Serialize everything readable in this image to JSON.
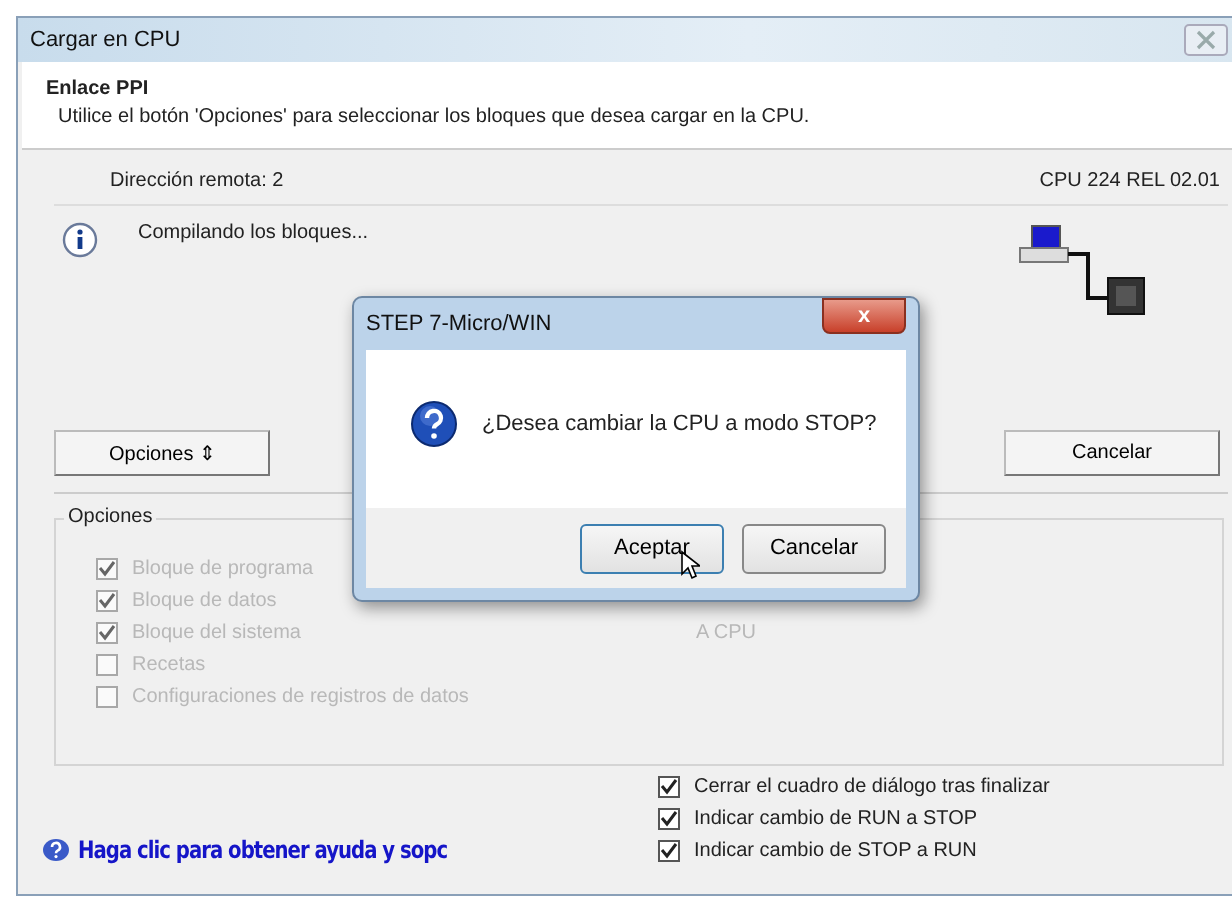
{
  "window": {
    "title": "Cargar en CPU"
  },
  "header": {
    "title": "Enlace PPI",
    "description": "Utilice el botón 'Opciones' para seleccionar los bloques que desea cargar en la CPU."
  },
  "connection": {
    "remote_address": "Dirección remota: 2",
    "cpu": "CPU 224 REL 02.01"
  },
  "status": {
    "message": "Compilando los bloques..."
  },
  "buttons": {
    "options": "Opciones ⇕",
    "cancel": "Cancelar"
  },
  "options_group": {
    "title": "Opciones",
    "items": [
      {
        "label": "Bloque de programa",
        "checked": true,
        "disabled": true
      },
      {
        "label": "Bloque de datos",
        "checked": true,
        "disabled": true
      },
      {
        "label": "Bloque del sistema",
        "checked": true,
        "disabled": true
      },
      {
        "label": "Recetas",
        "checked": false,
        "disabled": true
      },
      {
        "label": "Configuraciones de registros de datos",
        "checked": false,
        "disabled": true
      }
    ],
    "target": "A CPU"
  },
  "settings": [
    {
      "label": "Cerrar el cuadro de diálogo tras finalizar",
      "checked": true
    },
    {
      "label": "Indicar cambio de RUN a STOP",
      "checked": true
    },
    {
      "label": "Indicar cambio de STOP a RUN",
      "checked": true
    }
  ],
  "help_link": "Haga clic para obtener ayuda y sopc",
  "dialog": {
    "title": "STEP 7-Micro/WIN",
    "close": "x",
    "message": "¿Desea cambiar la CPU a modo STOP?",
    "buttons": [
      "Aceptar",
      "Cancelar"
    ]
  }
}
